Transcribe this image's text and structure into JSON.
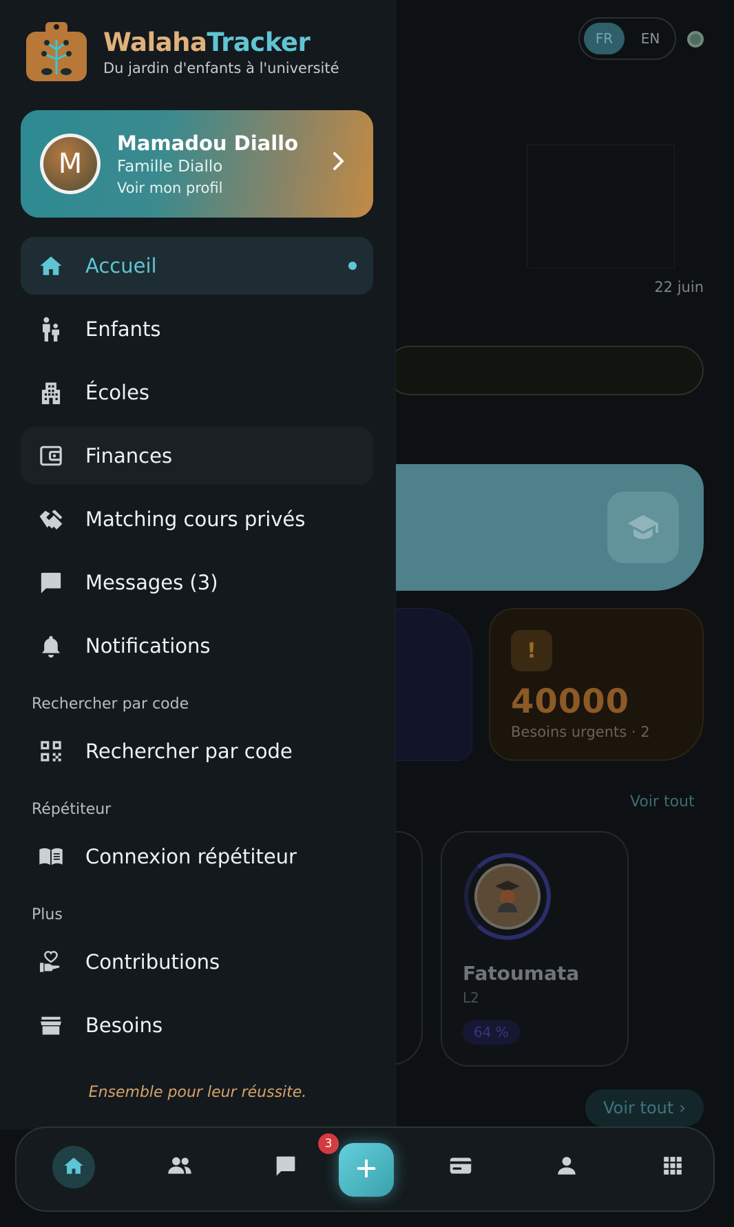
{
  "brand": {
    "title_part1": "Walaha",
    "title_part2": "Tracker",
    "subtitle": "Du jardin d'enfants à l'université"
  },
  "profile": {
    "initial": "M",
    "name": "Mamadou Diallo",
    "family": "Famille Diallo",
    "link": "Voir mon profil"
  },
  "nav": {
    "items": [
      {
        "label": "Accueil",
        "icon": "home-icon",
        "active": true
      },
      {
        "label": "Enfants",
        "icon": "family-icon"
      },
      {
        "label": "Écoles",
        "icon": "building-icon"
      },
      {
        "label": "Finances",
        "icon": "wallet-icon"
      },
      {
        "label": "Matching cours privés",
        "icon": "handshake-icon"
      },
      {
        "label": "Messages (3)",
        "icon": "chat-icon"
      },
      {
        "label": "Notifications",
        "icon": "bell-icon"
      }
    ],
    "section_search": "Rechercher par code",
    "search_item": {
      "label": "Rechercher par code",
      "icon": "qr-code-icon"
    },
    "section_tutor": "Répétiteur",
    "tutor_item": {
      "label": "Connexion répétiteur",
      "icon": "book-icon"
    },
    "section_more": "Plus",
    "more_items": [
      {
        "label": "Contributions",
        "icon": "donate-heart-icon"
      },
      {
        "label": "Besoins",
        "icon": "store-icon"
      }
    ]
  },
  "drawer_footer": "Ensemble pour leur réussite.",
  "background": {
    "lang_fr": "FR",
    "lang_en": "EN",
    "date_label": "22 juin",
    "urgent_value": "40000",
    "urgent_label": "Besoins urgents · 2",
    "voir_tout": "Voir tout",
    "child_name": "Fatoumata",
    "child_level": "L2",
    "child_progress": "64 %",
    "voir_tout_button": "Voir tout"
  },
  "bottom_bar": {
    "messages_badge": "3",
    "items": [
      "home-icon",
      "people-icon",
      "chat-icon",
      "add-icon",
      "payment-icon",
      "person-icon",
      "apps-grid-icon"
    ]
  },
  "colors": {
    "accent": "#5fc5d4",
    "brand_orange": "#e0b27a",
    "drawer_bg": "#14191d",
    "badge_red": "#d6393f"
  }
}
